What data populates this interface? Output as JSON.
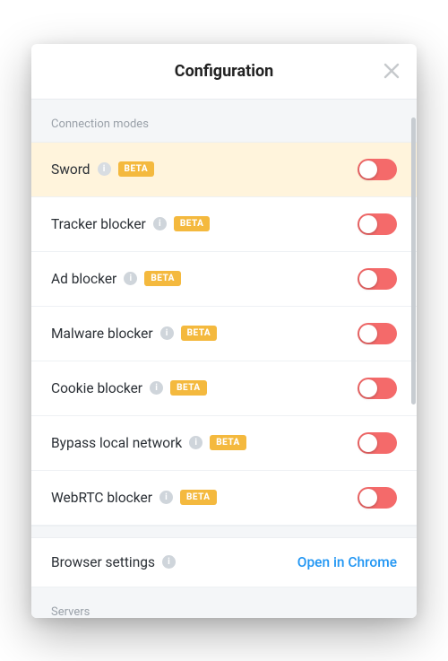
{
  "header": {
    "title": "Configuration"
  },
  "sections": {
    "connection_modes": {
      "header": "Connection modes",
      "items": [
        {
          "label": "Sword",
          "badge": "BETA",
          "info": true,
          "on": true,
          "highlight": true
        },
        {
          "label": "Tracker blocker",
          "badge": "BETA",
          "info": true,
          "on": true
        },
        {
          "label": "Ad blocker",
          "badge": "BETA",
          "info": true,
          "on": true
        },
        {
          "label": "Malware blocker",
          "badge": "BETA",
          "info": true,
          "on": true
        },
        {
          "label": "Cookie blocker",
          "badge": "BETA",
          "info": true,
          "on": true
        },
        {
          "label": "Bypass local network",
          "badge": "BETA",
          "info": true,
          "on": true
        },
        {
          "label": "WebRTC blocker",
          "badge": "BETA",
          "info": true,
          "on": true
        }
      ]
    },
    "browser": {
      "label": "Browser settings",
      "action": "Open in Chrome"
    },
    "servers": {
      "header": "Servers"
    }
  },
  "icons": {
    "close": "close-icon",
    "info": "info-icon"
  },
  "colors": {
    "accent_toggle": "#f46a6a",
    "badge": "#f4b93e",
    "link": "#2196f3",
    "highlight_row": "#fff4dc"
  }
}
